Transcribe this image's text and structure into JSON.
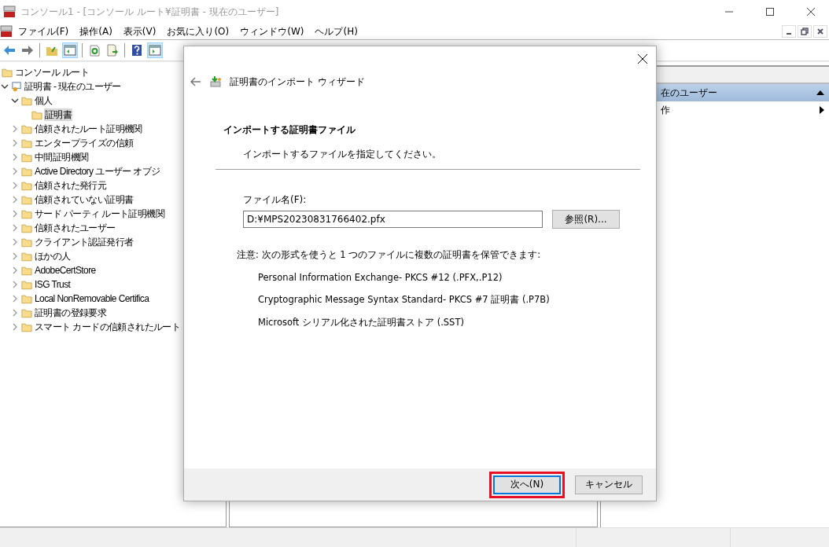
{
  "window": {
    "title": "コンソール1 - [コンソール ルート¥証明書 - 現在のユーザー]"
  },
  "menu": [
    "ファイル(F)",
    "操作(A)",
    "表示(V)",
    "お気に入り(O)",
    "ウィンドウ(W)",
    "ヘルプ(H)"
  ],
  "toolbar": [
    {
      "kind": "back",
      "pressed": false
    },
    {
      "kind": "forward",
      "pressed": false
    },
    {
      "kind": "sep"
    },
    {
      "kind": "up",
      "pressed": false
    },
    {
      "kind": "tree",
      "pressed": true
    },
    {
      "kind": "sep"
    },
    {
      "kind": "refresh",
      "pressed": false
    },
    {
      "kind": "export",
      "pressed": false
    },
    {
      "kind": "sep"
    },
    {
      "kind": "help",
      "pressed": false
    },
    {
      "kind": "actions",
      "pressed": true
    }
  ],
  "tree": [
    {
      "label": "コンソール ルート",
      "kind": "folder",
      "selected": false,
      "children": [
        {
          "label": "証明書 - 現在のユーザー",
          "kind": "console",
          "expanded": true,
          "selected": false,
          "children": [
            {
              "label": "個人",
              "kind": "folder",
              "expanded": true,
              "selected": false,
              "children": [
                {
                  "label": "証明書",
                  "kind": "folder",
                  "selected": true
                }
              ]
            },
            {
              "label": "信頼されたルート証明機関",
              "kind": "folder",
              "expanded": false,
              "selected": false
            },
            {
              "label": "エンタープライズの信頼",
              "kind": "folder",
              "expanded": false,
              "selected": false
            },
            {
              "label": "中間証明機関",
              "kind": "folder",
              "expanded": false,
              "selected": false
            },
            {
              "label": "Active Directory ユーザー オブジ",
              "kind": "folder",
              "expanded": false,
              "selected": false
            },
            {
              "label": "信頼された発行元",
              "kind": "folder",
              "expanded": false,
              "selected": false
            },
            {
              "label": "信頼されていない証明書",
              "kind": "folder",
              "expanded": false,
              "selected": false
            },
            {
              "label": "サード パーティ ルート証明機関",
              "kind": "folder",
              "expanded": false,
              "selected": false
            },
            {
              "label": "信頼されたユーザー",
              "kind": "folder",
              "expanded": false,
              "selected": false
            },
            {
              "label": "クライアント認証発行者",
              "kind": "folder",
              "expanded": false,
              "selected": false
            },
            {
              "label": "ほかの人",
              "kind": "folder",
              "expanded": false,
              "selected": false
            },
            {
              "label": "AdobeCertStore",
              "kind": "folder",
              "expanded": false,
              "selected": false
            },
            {
              "label": "ISG Trust",
              "kind": "folder",
              "expanded": false,
              "selected": false
            },
            {
              "label": "Local NonRemovable Certifica",
              "kind": "folder",
              "expanded": false,
              "selected": false
            },
            {
              "label": "証明書の登録要求",
              "kind": "folder",
              "expanded": false,
              "selected": false
            },
            {
              "label": "スマート カードの信頼されたルート",
              "kind": "folder",
              "expanded": false,
              "selected": false
            }
          ]
        }
      ]
    }
  ],
  "actions": {
    "header": "在のユーザー",
    "expanded": true,
    "items": [
      "作"
    ]
  },
  "dialog": {
    "title": "証明書のインポート ウィザード",
    "heading": "インポートする証明書ファイル",
    "subheading": "インポートするファイルを指定してください。",
    "file_label": "ファイル名(F):",
    "file_value": "D:¥MPS20230831766402.pfx",
    "browse": "参照(R)...",
    "note": "注意: 次の形式を使うと 1 つのファイルに複数の証明書を保管できます:",
    "formats": [
      "Personal Information Exchange- PKCS #12 (.PFX,.P12)",
      "Cryptographic Message Syntax Standard- PKCS #7 証明書 (.P7B)",
      "Microsoft シリアル化された証明書ストア (.SST)"
    ],
    "buttons": [
      {
        "label": "次へ(N)",
        "focused": true,
        "highlighted": true
      },
      {
        "label": "キャンセル",
        "focused": false,
        "highlighted": false
      }
    ]
  }
}
